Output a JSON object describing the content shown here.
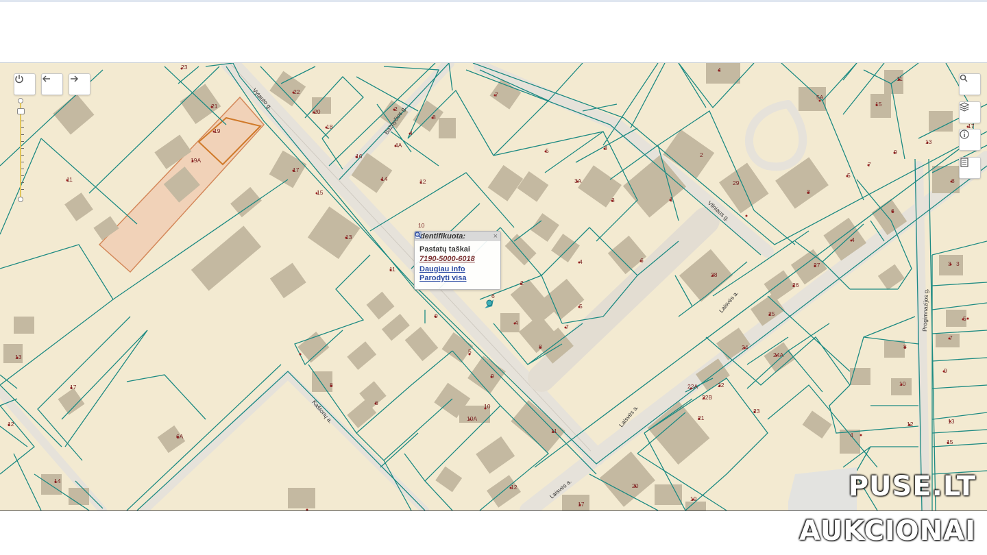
{
  "map": {
    "streets": [
      "Vytauto g.",
      "Bažnyčios g.",
      "Vilniaus g.",
      "Laisvės a.",
      "Laisvės a.",
      "Laisvės a.",
      "Kaštonų a.",
      "Progimnazijos g."
    ],
    "parcel_numbers": [
      "23",
      "22",
      "20",
      "18",
      "16",
      "21",
      "19",
      "19A",
      "17",
      "15",
      "11",
      "13",
      "11",
      "10",
      "9",
      "8",
      "6",
      "10A",
      "10",
      "9",
      "5",
      "11",
      "12",
      "14",
      "12",
      "4A",
      "4",
      "8",
      "2",
      "7",
      "5",
      "3",
      "3A",
      "3",
      "1",
      "4",
      "6",
      "2",
      "5",
      "7",
      "8",
      "6",
      "4",
      "29",
      "28",
      "3",
      "4",
      "5A",
      "11",
      "15",
      "17",
      "13",
      "9",
      "7",
      "5",
      "27",
      "26",
      "25",
      "24",
      "24A",
      "22A",
      "22B",
      "22",
      "23",
      "21",
      "20",
      "19",
      "17",
      "14",
      "12",
      "13",
      "17",
      "6A",
      "3",
      "2",
      "4",
      "8",
      "3",
      "5",
      "7",
      "8",
      "9",
      "10",
      "12",
      "13",
      "15",
      "6",
      "4"
    ],
    "popup": {
      "title": "Identifikuota:",
      "close": "×",
      "type": "Pastatų taškai",
      "number": "7190-5000-6018",
      "link_more": "Daugiau info",
      "link_show": "Parodyti visa"
    },
    "controls": {
      "power_icon": "power-icon",
      "back_icon": "arrow-left-icon",
      "forward_icon": "arrow-right-icon",
      "search_icon": "search-icon",
      "layers_icon": "layers-icon",
      "info_icon": "info-icon",
      "legend_icon": "legend-icon"
    }
  },
  "branding": {
    "line1": "PUSE.LT",
    "line2": "AUKCIONAI"
  },
  "colors": {
    "land": "#f3ead1",
    "parcel_line": "#1c8a82",
    "building": "#c4b9a1",
    "road": "#e6e2da",
    "highlight": "#d4885a"
  }
}
